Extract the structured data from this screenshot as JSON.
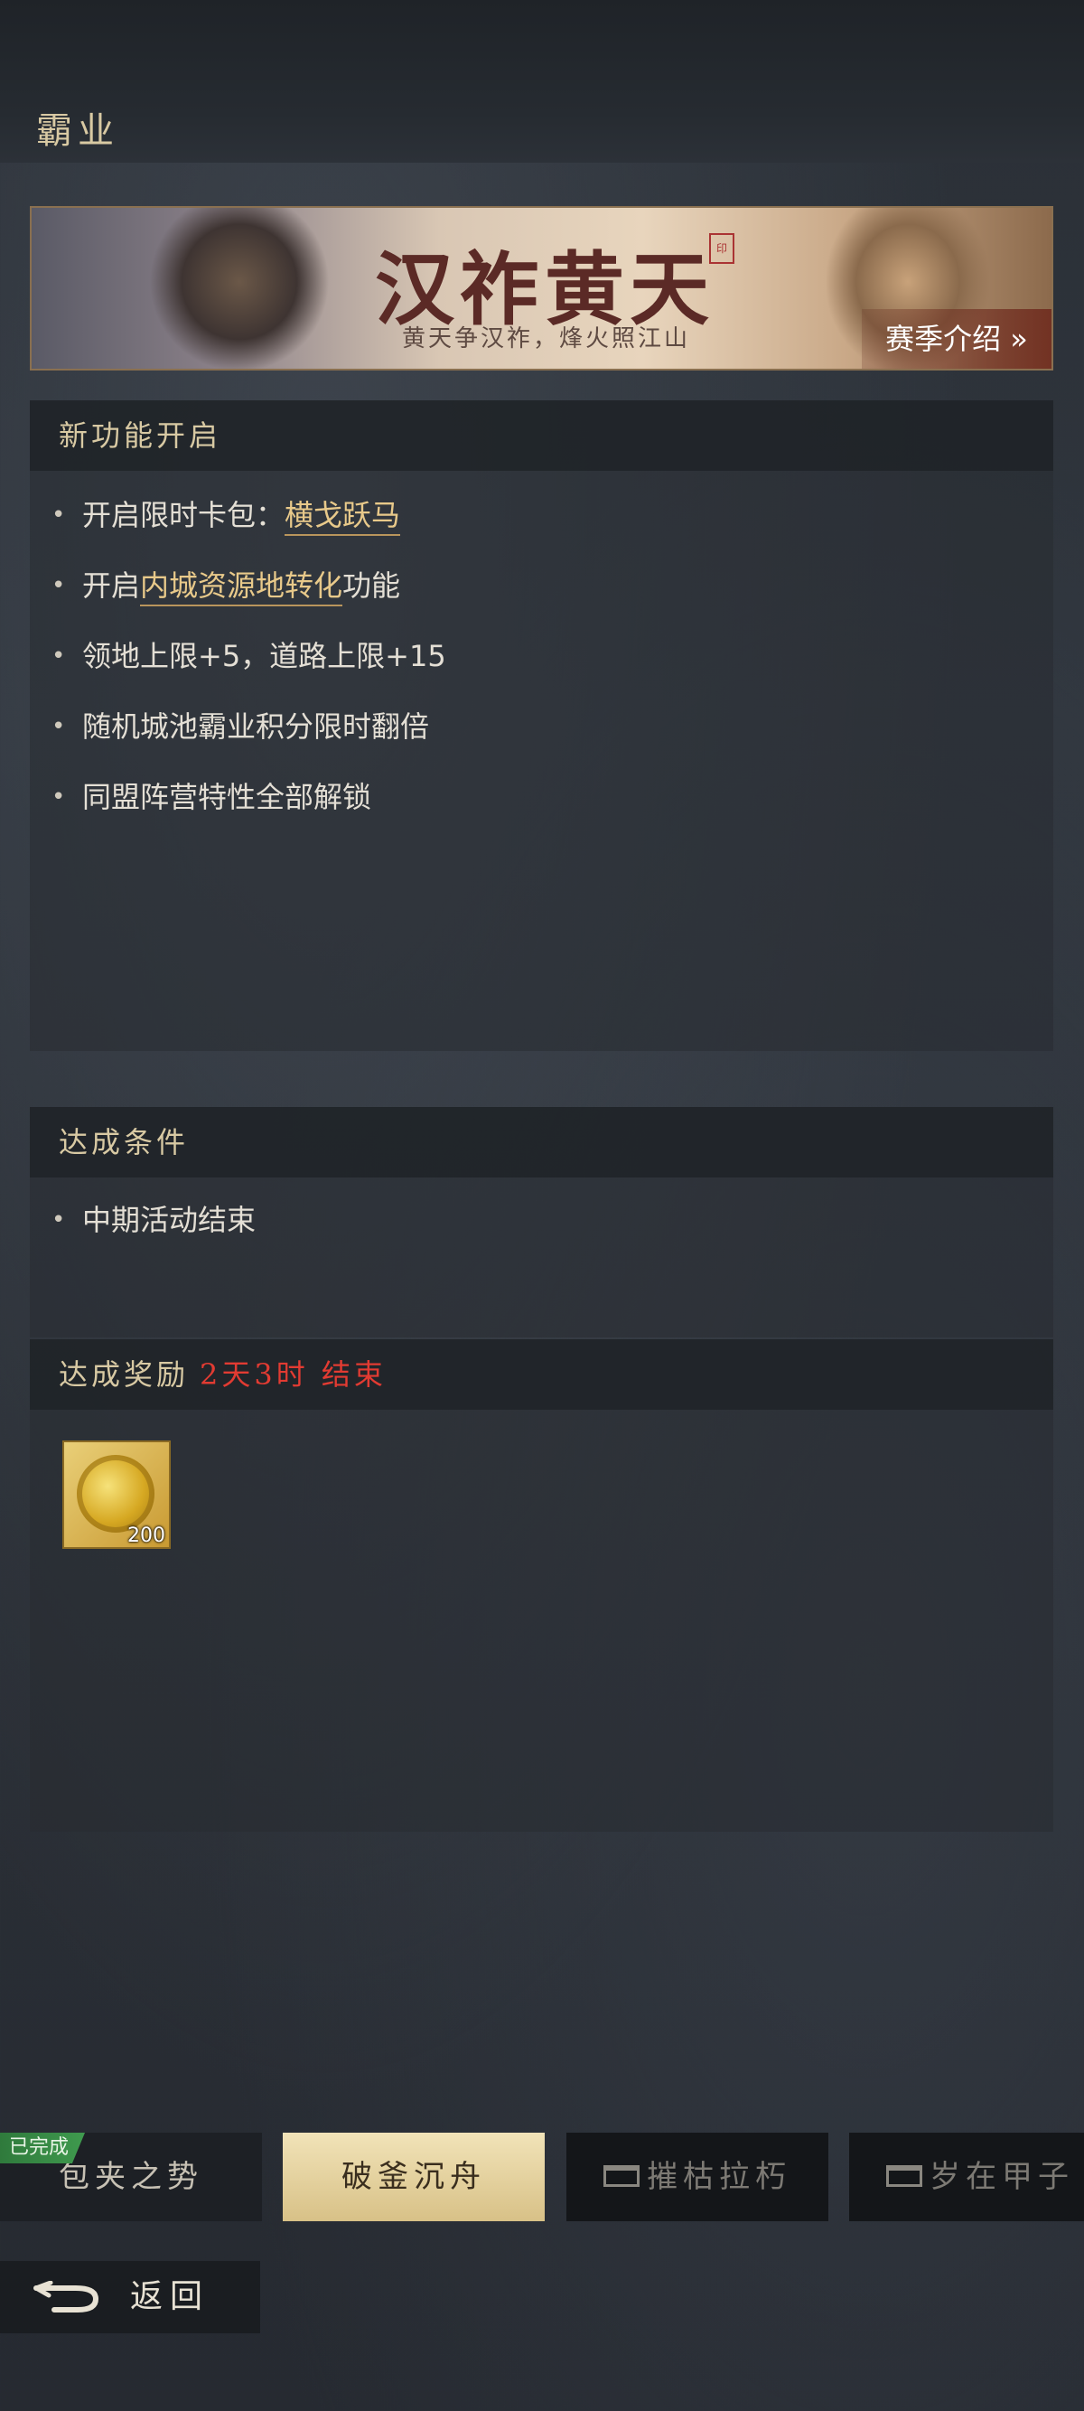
{
  "header": {
    "title": "霸业"
  },
  "banner": {
    "title": "汉祚黄天",
    "subtitle": "黄天争汉祚，烽火照江山",
    "season_button": "赛季介绍 »"
  },
  "features": {
    "heading": "新功能开启",
    "items": [
      {
        "prefix": "开启限时卡包：",
        "highlight": "横戈跃马",
        "suffix": ""
      },
      {
        "prefix": "开启",
        "highlight": "内城资源地转化",
        "suffix": "功能"
      },
      {
        "text": "领地上限+5，道路上限+15"
      },
      {
        "text": "随机城池霸业积分限时翻倍"
      },
      {
        "text": "同盟阵营特性全部解锁"
      }
    ]
  },
  "conditions": {
    "heading": "达成条件",
    "items": [
      "中期活动结束"
    ]
  },
  "reward": {
    "heading": "达成奖励",
    "countdown": "2天3时 结束",
    "items": [
      {
        "icon": "gold-coin-icon",
        "count": "200"
      }
    ]
  },
  "tabs": [
    {
      "label": "包夹之势",
      "badge": "已完成",
      "state": "completed"
    },
    {
      "label": "破釜沉舟",
      "state": "active"
    },
    {
      "label": "摧枯拉朽",
      "state": "locked"
    },
    {
      "label": "岁在甲子",
      "state": "locked"
    }
  ],
  "back": {
    "label": "返回"
  },
  "colors": {
    "accent_gold": "#d8c9a3",
    "highlight": "#e8c98a",
    "countdown_red": "#e23b32",
    "active_tab": "#e6d49e",
    "completed_badge": "#3f9a4e"
  }
}
